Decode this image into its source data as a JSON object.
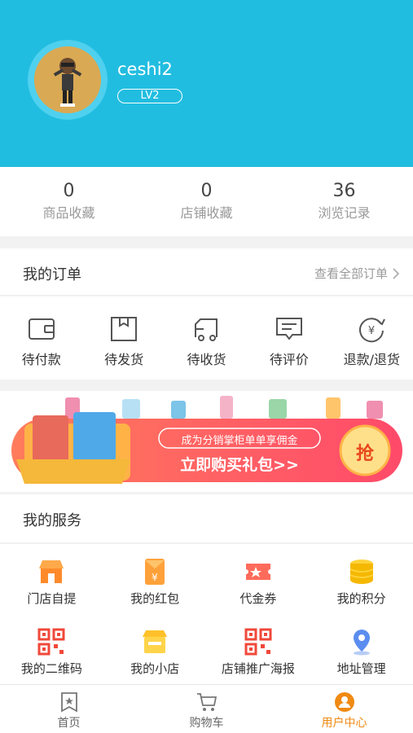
{
  "profile": {
    "username": "ceshi2",
    "level": "LV2"
  },
  "stats": [
    {
      "value": "0",
      "label": "商品收藏"
    },
    {
      "value": "0",
      "label": "店铺收藏"
    },
    {
      "value": "36",
      "label": "浏览记录"
    }
  ],
  "orders": {
    "title": "我的订单",
    "view_all": "查看全部订单",
    "items": [
      {
        "label": "待付款",
        "icon": "wallet-icon"
      },
      {
        "label": "待发货",
        "icon": "package-icon"
      },
      {
        "label": "待收货",
        "icon": "truck-icon"
      },
      {
        "label": "待评价",
        "icon": "comment-icon"
      },
      {
        "label": "退款/退货",
        "icon": "refund-icon"
      }
    ]
  },
  "banner": {
    "subtitle": "成为分销掌柜单单享佣金",
    "main": "立即购买礼包>>",
    "button": "抢"
  },
  "services": {
    "title": "我的服务",
    "items": [
      {
        "label": "门店自提",
        "icon": "store-icon"
      },
      {
        "label": "我的红包",
        "icon": "red-envelope-icon"
      },
      {
        "label": "代金券",
        "icon": "coupon-icon"
      },
      {
        "label": "我的积分",
        "icon": "coins-icon"
      },
      {
        "label": "我的二维码",
        "icon": "qrcode-icon"
      },
      {
        "label": "我的小店",
        "icon": "shop-icon"
      },
      {
        "label": "店铺推广海报",
        "icon": "qrcode-poster-icon"
      },
      {
        "label": "地址管理",
        "icon": "location-pin-icon"
      }
    ]
  },
  "tabbar": [
    {
      "label": "首页",
      "icon": "home-bookmark-icon"
    },
    {
      "label": "购物车",
      "icon": "cart-icon"
    },
    {
      "label": "用户中心",
      "icon": "user-icon",
      "active": true
    }
  ],
  "colors": {
    "header_bg": "#21bde0",
    "accent": "#f08a13"
  }
}
